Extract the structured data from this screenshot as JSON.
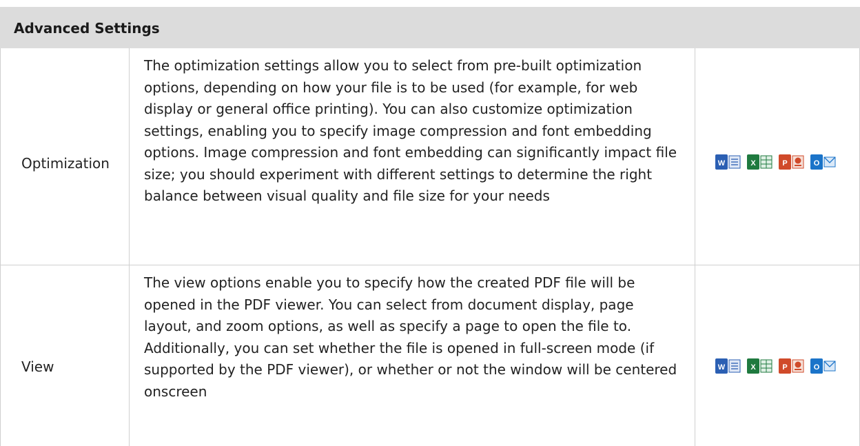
{
  "header": {
    "title": "Advanced Settings"
  },
  "rows": [
    {
      "label": "Optimization",
      "description": "The optimization settings allow you to select from pre-built optimization options, depending on how your file is to be used (for example, for web display or general office printing). You can also customize optimization settings, enabling you to specify image compression and font embedding options. Image compression and font embedding can significantly impact file size; you should experiment with different settings to determine the right balance between visual quality and file size for your needs",
      "icons": [
        "word-icon",
        "excel-icon",
        "powerpoint-icon",
        "outlook-icon"
      ]
    },
    {
      "label": "View",
      "description": "The view options enable you to specify how the created PDF file will be opened in the PDF viewer. You can select from document display, page layout, and zoom options, as well as specify a page to open the file to. Additionally, you can set whether the file is opened in full-screen mode (if supported by the PDF viewer), or whether or not the window will be centered onscreen",
      "icons": [
        "word-icon",
        "excel-icon",
        "powerpoint-icon",
        "outlook-icon"
      ]
    }
  ],
  "colors": {
    "header_bg": "#dcdcdc",
    "border": "#cfcfcf",
    "word": "#2b5fb3",
    "excel": "#1f7a3f",
    "powerpoint": "#d04a2a",
    "outlook": "#1b74c9"
  }
}
